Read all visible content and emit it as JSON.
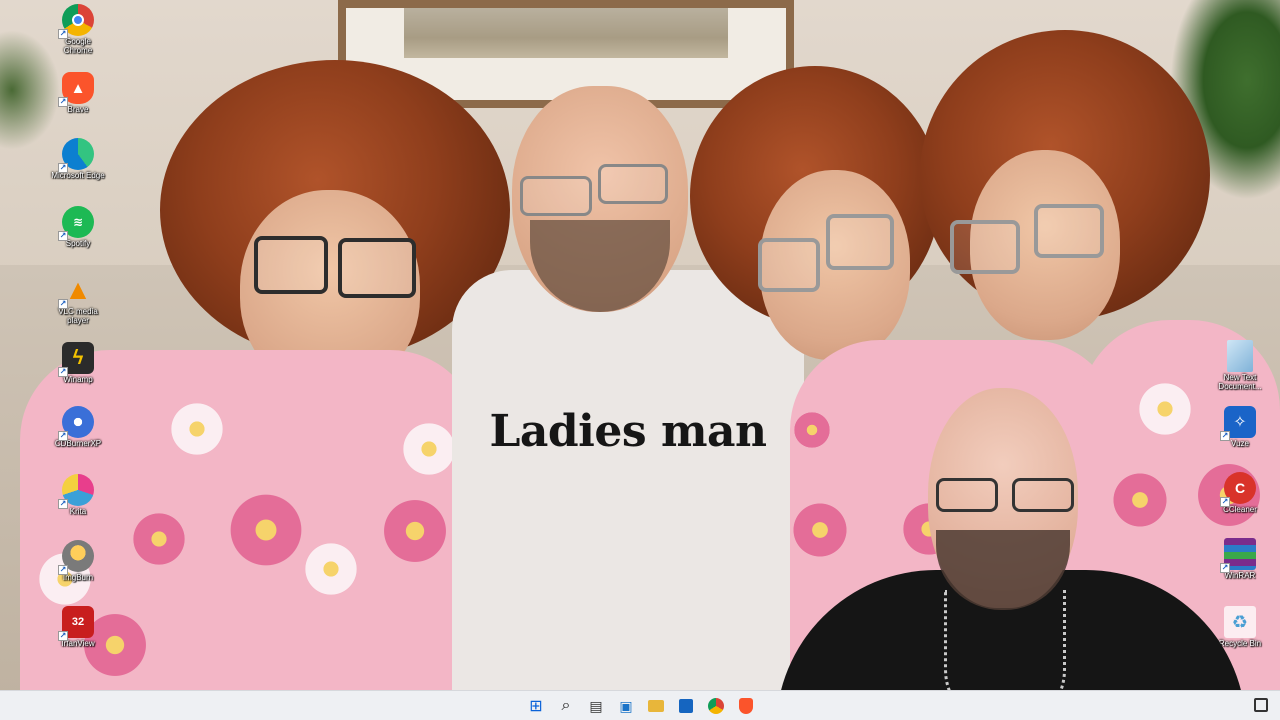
{
  "desktop": {
    "left_icons": [
      {
        "label": "Google Chrome",
        "icon": "chrome-icon",
        "color": "#db4437"
      },
      {
        "label": "Brave",
        "icon": "brave-icon",
        "color": "#fb542b"
      },
      {
        "label": "Microsoft Edge",
        "icon": "edge-icon",
        "color": "#0c7fd0"
      },
      {
        "label": "Spotify",
        "icon": "spotify-icon",
        "color": "#1db954"
      },
      {
        "label": "VLC media player",
        "icon": "vlc-icon",
        "color": "#f08a00"
      },
      {
        "label": "Winamp",
        "icon": "winamp-icon",
        "color": "#e0a800"
      },
      {
        "label": "CDBurnerXP",
        "icon": "cdburnerxp-icon",
        "color": "#3a6fd8"
      },
      {
        "label": "Krita",
        "icon": "krita-icon",
        "color": "#3aa0d8"
      },
      {
        "label": "ImgBurn",
        "icon": "imgburn-icon",
        "color": "#7a7a7a"
      },
      {
        "label": "IrfanView",
        "icon": "irfanview-icon",
        "color": "#c81e1e"
      }
    ],
    "right_icons": [
      {
        "label": "New Text Document...",
        "icon": "text-document-icon",
        "color": "#7fb2d8"
      },
      {
        "label": "Vuze",
        "icon": "vuze-icon",
        "color": "#1a64c8"
      },
      {
        "label": "CCleaner",
        "icon": "ccleaner-icon",
        "color": "#d9332a"
      },
      {
        "label": "WinRAR",
        "icon": "winrar-icon",
        "color": "#7a2c8c"
      },
      {
        "label": "Recycle Bin",
        "icon": "recycle-bin-icon",
        "color": "#4a9fd4"
      }
    ],
    "irfanview_badge": "32"
  },
  "wallpaper": {
    "shirt_text": "Ladies man"
  },
  "taskbar": {
    "buttons": [
      {
        "name": "start",
        "icon": "windows-start-icon",
        "glyph": "⊞",
        "color": "#0a62d8"
      },
      {
        "name": "search",
        "icon": "search-icon",
        "glyph": "⌕",
        "color": "#222222"
      },
      {
        "name": "task-view",
        "icon": "task-view-icon",
        "glyph": "▤",
        "color": "#333333"
      },
      {
        "name": "widgets",
        "icon": "widgets-icon",
        "glyph": "▣",
        "color": "#1a73c8"
      },
      {
        "name": "file-explorer",
        "icon": "folder-icon",
        "glyph": "▭",
        "color": "#e8b63a"
      },
      {
        "name": "store",
        "icon": "store-icon",
        "glyph": "▦",
        "color": "#1565c0"
      },
      {
        "name": "chrome",
        "icon": "chrome-icon",
        "glyph": "◉",
        "color": "#db4437"
      },
      {
        "name": "brave",
        "icon": "brave-icon",
        "glyph": "◆",
        "color": "#fb542b"
      }
    ]
  }
}
